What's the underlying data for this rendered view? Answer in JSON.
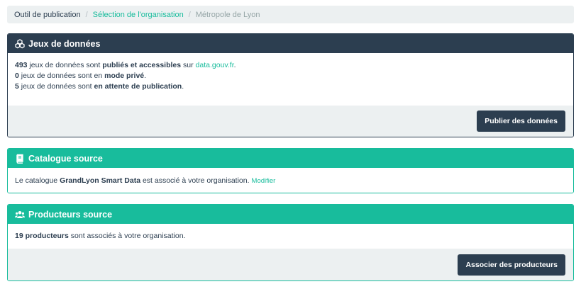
{
  "breadcrumb": {
    "items": [
      {
        "label": "Outil de publication"
      },
      {
        "label": "Sélection de l'organisation"
      },
      {
        "label": "Métropole de Lyon"
      }
    ],
    "separator": "/"
  },
  "datasets_panel": {
    "title": "Jeux de données",
    "icon": "cubes-icon",
    "line1": {
      "count": "493",
      "text_a": " jeux de données sont ",
      "bold": "publiés et accessibles",
      "text_b": " sur ",
      "link": "data.gouv.fr",
      "end": "."
    },
    "line2": {
      "count": "0",
      "text_a": " jeux de données sont en ",
      "bold": "mode privé",
      "end": "."
    },
    "line3": {
      "count": "5",
      "text_a": " jeux de données sont ",
      "bold": "en attente de publication",
      "end": "."
    },
    "button_label": "Publier des données"
  },
  "catalog_panel": {
    "title": "Catalogue source",
    "icon": "book-icon",
    "text_a": "Le catalogue ",
    "catalog_name": "GrandLyon Smart Data",
    "text_b": " est associé à votre organisation.",
    "modify_link": "Modifier"
  },
  "producers_panel": {
    "title": "Producteurs source",
    "icon": "users-icon",
    "count_bold": "19 producteurs",
    "text": " sont associés à votre organisation.",
    "button_label": "Associer des producteurs"
  },
  "colors": {
    "primary_dark": "#2c3e50",
    "accent_teal": "#18bc9c",
    "light_bg": "#ecf0f1"
  }
}
